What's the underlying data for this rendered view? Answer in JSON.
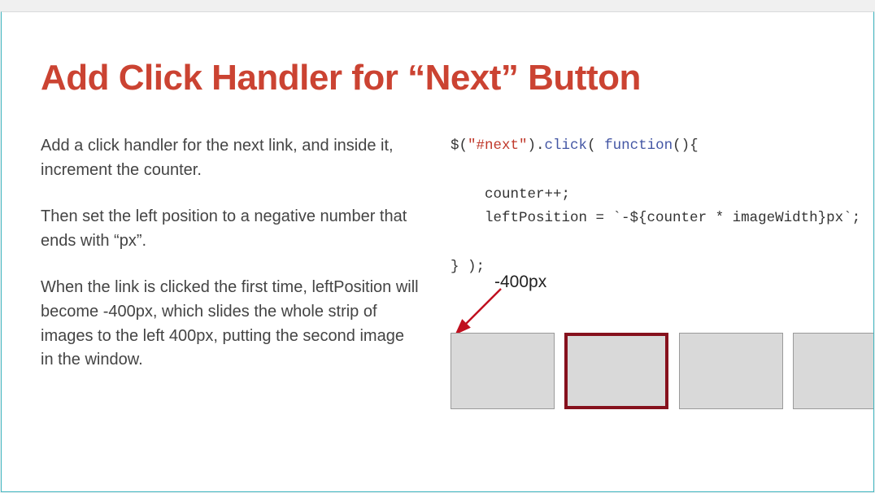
{
  "title": "Add Click Handler for “Next” Button",
  "paragraphs": {
    "p1": "Add a click handler for the next link, and inside it, increment the counter.",
    "p2": "Then set the left position to a negative number that ends with “px”.",
    "p3": "When the link is clicked the first time, leftPosition will become -400px, which slides the whole strip of images to the left 400px, putting the second image in the window."
  },
  "code": {
    "line1_dollar": "$(",
    "line1_sel": "\"#next\"",
    "line1_dot": ").",
    "line1_click": "click",
    "line1_open": "( ",
    "line1_func": "function",
    "line1_paren": "(){",
    "line2": "    counter++;",
    "line3_a": "    leftPosition = ",
    "line3_tmpl": "`-${counter * imageWidth}px`",
    "line3_b": ";",
    "line5": "} );"
  },
  "diagram": {
    "label": "-400px",
    "selected_index": 1,
    "box_count": 4
  }
}
